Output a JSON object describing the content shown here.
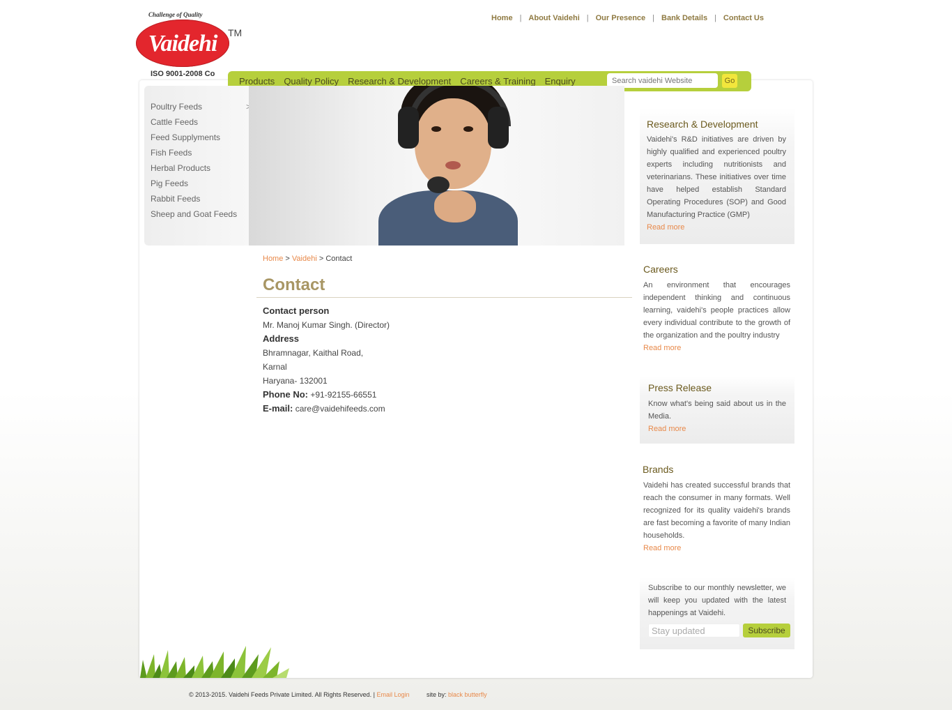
{
  "logo": {
    "tagline": "Challenge of Quality",
    "brand": "Vaidehi",
    "tm": "TM",
    "iso": "ISO 9001-2008 Co"
  },
  "topnav": [
    "Home",
    "About Vaidehi",
    "Our Presence",
    "Bank Details",
    "Contact Us"
  ],
  "topnav_separator": "|",
  "mainmenu": [
    "Products",
    "Quality Policy",
    "Research & Development",
    "Careers & Training",
    "Enquiry"
  ],
  "search": {
    "placeholder": "Search vaidehi Website",
    "button": "Go"
  },
  "sidebar": {
    "items": [
      "Poultry Feeds",
      "Cattle Feeds",
      "Feed Supplyments",
      "Fish Feeds",
      "Herbal Products",
      "Pig Feeds",
      "Rabbit Feeds",
      "Sheep and Goat Feeds"
    ],
    "arrow": ">"
  },
  "breadcrumb": {
    "home": "Home",
    "sep": ">",
    "section": "Vaidehi",
    "current": "Contact"
  },
  "content": {
    "title": "Contact",
    "contact_person_label": "Contact person",
    "contact_person": "Mr. Manoj Kumar Singh. (Director)",
    "address_label": "Address",
    "address_line1": "Bhramnagar, Kaithal Road,",
    "address_line2": "Karnal",
    "address_line3": "Haryana- 132001",
    "phone_label": "Phone No:",
    "phone": "+91-92155-66551",
    "email_label": "E-mail:",
    "email": "care@vaidehifeeds.com"
  },
  "right": {
    "rd": {
      "title": "Research & Development",
      "text": "Vaidehi's R&D initiatives are driven by highly qualified and experienced poultry experts including nutritionists and veterinarians. These initiatives over time have helped establish Standard Operating Procedures (SOP) and Good Manufacturing Practice (GMP)",
      "more": "Read more"
    },
    "careers": {
      "title": "Careers",
      "text": "An environment that encourages independent thinking and continuous learning, vaidehi's people practices allow every individual contribute to the growth of the organization and the poultry industry",
      "more": "Read more"
    },
    "press": {
      "title": "Press Release",
      "text": "Know what's being said about us in the Media.",
      "more": "Read more"
    },
    "brands": {
      "title": "Brands",
      "text": "Vaidehi has created successful brands that reach the consumer in many formats. Well recognized for its quality vaidehi's brands are fast becoming a favorite of many Indian households.",
      "more": "Read more"
    },
    "newsletter": {
      "text": "Subscribe to our monthly newsletter, we will keep you updated with the latest happenings at Vaidehi.",
      "placeholder": "Stay updated",
      "button": "Subscribe"
    }
  },
  "footer": {
    "copyright": "© 2013-2015. Vaidehi Feeds Private Limited. All Rights Reserved. |",
    "email_login": "Email Login",
    "site_by_label": "site by:",
    "site_by": "black butterfly"
  },
  "colors": {
    "accent_green": "#b6cf3c",
    "link_orange": "#e8894a",
    "title_gold": "#a89664",
    "brand_red": "#e3262d"
  }
}
